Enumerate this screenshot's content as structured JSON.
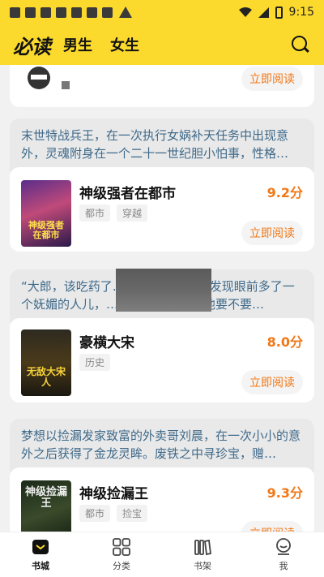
{
  "status": {
    "time": "9:15"
  },
  "header": {
    "logo": "必读",
    "tabs": [
      "男生",
      "女生"
    ]
  },
  "cards": [
    {
      "read_label": "立即阅读"
    },
    {
      "blurb": "末世特战兵王，在一次执行女娲补天任务中出现意外，灵魂附身在一个二十一世纪胆小怕事，性格…",
      "title": "神级强者在都市",
      "score": "9.2分",
      "tags": [
        "都市",
        "穿越"
      ],
      "read_label": "立即阅读",
      "cover_text": "神级强者在都市"
    },
    {
      "blurb": "“大郎，该吃药了…………………然发现眼前多了一个妩媚的人儿，………………药，他要不要…",
      "title": "豪横大宋",
      "score": "8.0分",
      "tags": [
        "历史"
      ],
      "read_label": "立即阅读",
      "cover_text": "无敌大宋人"
    },
    {
      "blurb": "梦想以捡漏发家致富的外卖哥刘晨，在一次小小的意外之后获得了金龙灵眸。废铁之中寻珍宝，赠…",
      "title": "神级捡漏王",
      "score": "9.3分",
      "tags": [
        "都市",
        "捡宝"
      ],
      "read_label": "立即阅读",
      "cover_text": "神级捡漏王"
    }
  ],
  "bottom_nav": [
    {
      "label": "书城",
      "icon": "bookstore-icon"
    },
    {
      "label": "分类",
      "icon": "category-icon"
    },
    {
      "label": "书架",
      "icon": "bookshelf-icon"
    },
    {
      "label": "我",
      "icon": "profile-icon"
    }
  ],
  "colors": {
    "brand": "#fbd92d",
    "accent": "#f07818",
    "blurb": "#3f6a8a"
  }
}
